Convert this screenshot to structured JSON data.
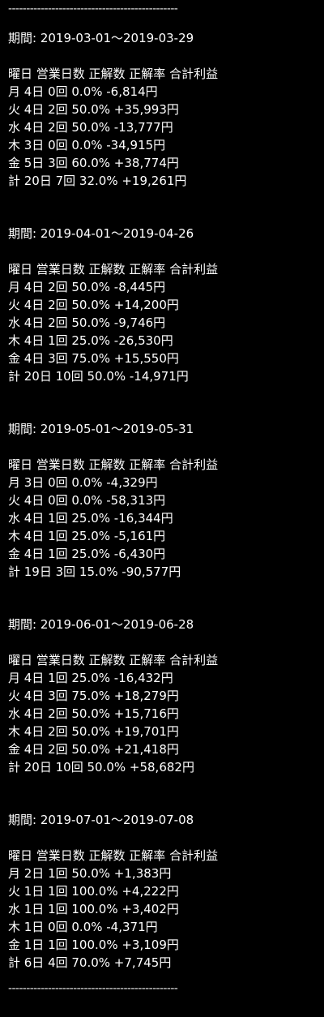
{
  "divider": "-----------------------------------------------",
  "sections": [
    {
      "period": "期間: 2019-03-01～2019-03-29",
      "header": "曜日 営業日数 正解数 正解率 合計利益",
      "rows": [
        "月 4日 0回 0.0% -6,814円",
        "火 4日 2回 50.0% +35,993円",
        "水 4日 2回 50.0% -13,777円",
        "木 3日 0回 0.0% -34,915円",
        "金 5日 3回 60.0% +38,774円",
        "計 20日 7回 32.0% +19,261円"
      ]
    },
    {
      "period": "期間: 2019-04-01～2019-04-26",
      "header": "曜日 営業日数 正解数 正解率 合計利益",
      "rows": [
        "月 4日 2回 50.0% -8,445円",
        "火 4日 2回 50.0% +14,200円",
        "水 4日 2回 50.0% -9,746円",
        "木 4日 1回 25.0% -26,530円",
        "金 4日 3回 75.0% +15,550円",
        "計 20日 10回 50.0% -14,971円"
      ]
    },
    {
      "period": "期間: 2019-05-01～2019-05-31",
      "header": "曜日 営業日数 正解数 正解率 合計利益",
      "rows": [
        "月 3日 0回 0.0% -4,329円",
        "火 4日 0回 0.0% -58,313円",
        "水 4日 1回 25.0% -16,344円",
        "木 4日 1回 25.0% -5,161円",
        "金 4日 1回 25.0% -6,430円",
        "計 19日 3回 15.0% -90,577円"
      ]
    },
    {
      "period": "期間: 2019-06-01～2019-06-28",
      "header": "曜日 営業日数 正解数 正解率 合計利益",
      "rows": [
        "月 4日 1回 25.0% -16,432円",
        "火 4日 3回 75.0% +18,279円",
        "水 4日 2回 50.0% +15,716円",
        "木 4日 2回 50.0% +19,701円",
        "金 4日 2回 50.0% +21,418円",
        "計 20日 10回 50.0% +58,682円"
      ]
    },
    {
      "period": "期間: 2019-07-01～2019-07-08",
      "header": "曜日 営業日数 正解数 正解率 合計利益",
      "rows": [
        "月 2日 1回 50.0% +1,383円",
        "火 1日 1回 100.0% +4,222円",
        "水 1日 1回 100.0% +3,402円",
        "木 1日 0回 0.0% -4,371円",
        "金 1日 1回 100.0% +3,109円",
        "計 6日 4回 70.0% +7,745円"
      ]
    }
  ]
}
